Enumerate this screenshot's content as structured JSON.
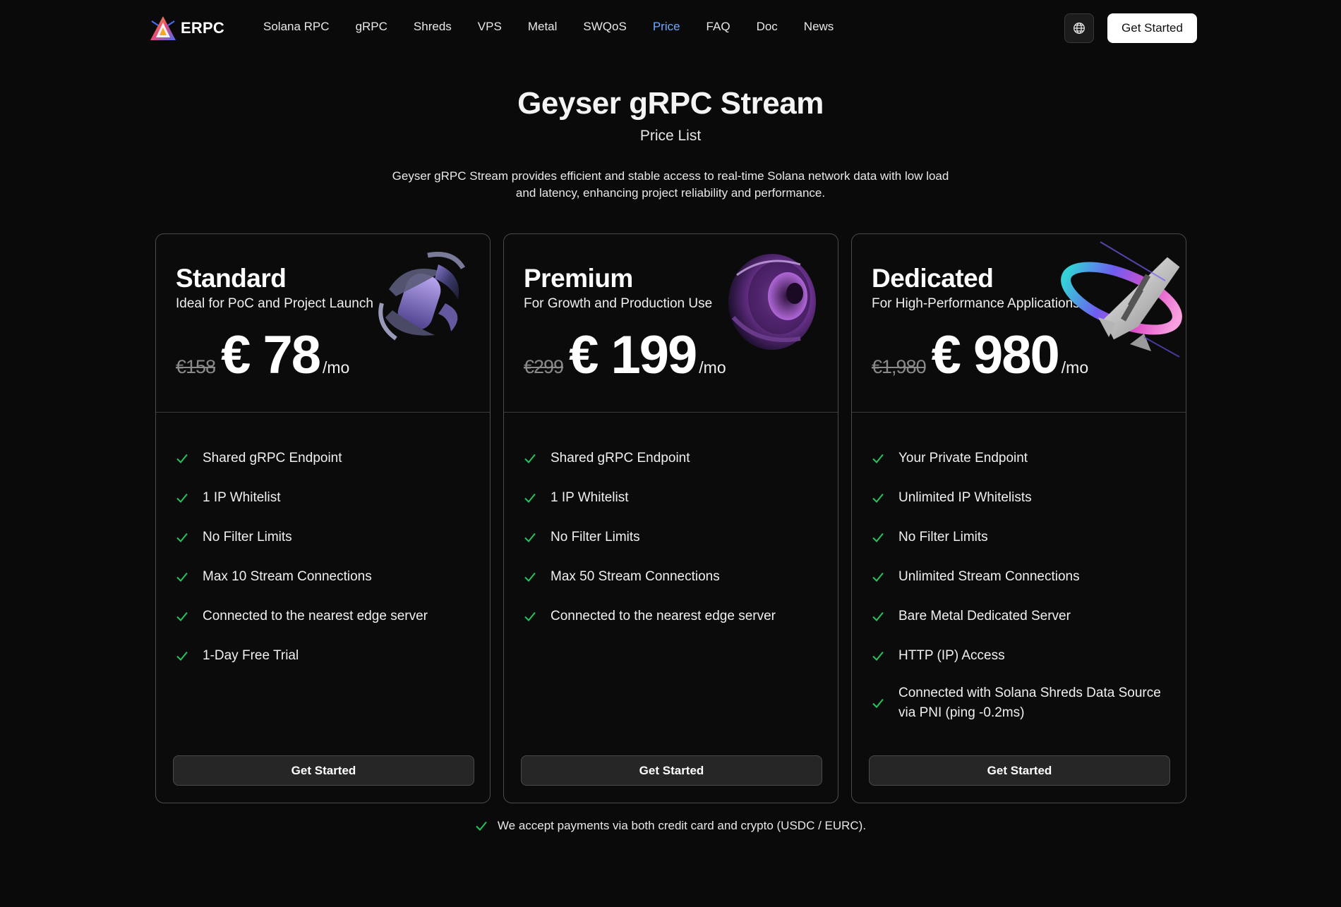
{
  "brand": {
    "name": "ERPC"
  },
  "nav": {
    "links": [
      {
        "label": "Solana RPC"
      },
      {
        "label": "gRPC"
      },
      {
        "label": "Shreds"
      },
      {
        "label": "VPS"
      },
      {
        "label": "Metal"
      },
      {
        "label": "SWQoS"
      },
      {
        "label": "Price",
        "active": true
      },
      {
        "label": "FAQ"
      },
      {
        "label": "Doc"
      },
      {
        "label": "News"
      }
    ],
    "language_icon": "globe-icon",
    "cta_label": "Get Started"
  },
  "hero": {
    "title": "Geyser gRPC Stream",
    "subtitle": "Price List",
    "description": "Geyser gRPC Stream provides efficient and stable access to real-time Solana network data with low load and latency, enhancing project reliability and performance."
  },
  "plans": [
    {
      "name": "Standard",
      "tagline": "Ideal for PoC and Project Launch",
      "old_price": "€158",
      "price": "€ 78",
      "unit": "/mo",
      "features": [
        "Shared gRPC Endpoint",
        "1 IP Whitelist",
        "No Filter Limits",
        "Max 10 Stream Connections",
        "Connected to the nearest edge server",
        "1-Day Free Trial"
      ],
      "button_label": "Get Started"
    },
    {
      "name": "Premium",
      "tagline": "For Growth and Production Use",
      "old_price": "€299",
      "price": "€ 199",
      "unit": "/mo",
      "features": [
        "Shared gRPC Endpoint",
        "1 IP Whitelist",
        "No Filter Limits",
        "Max 50 Stream Connections",
        "Connected to the nearest edge server"
      ],
      "button_label": "Get Started"
    },
    {
      "name": "Dedicated",
      "tagline": "For High-Performance Applications",
      "old_price": "€1,980",
      "price": "€ 980",
      "unit": "/mo",
      "features": [
        "Your Private Endpoint",
        "Unlimited IP Whitelists",
        "No Filter Limits",
        "Unlimited Stream Connections",
        "Bare Metal Dedicated Server",
        "HTTP (IP) Access",
        "Connected with Solana Shreds Data Source via PNI (ping -0.2ms)"
      ],
      "button_label": "Get Started"
    }
  ],
  "footnote": "We accept payments via both credit card and crypto (USDC / EURC).",
  "colors": {
    "background": "#0a0a0a",
    "accent_link": "#6ea8fe",
    "check": "#22c55e",
    "card_border": "#4a4a4a",
    "button_bg": "#262626"
  }
}
